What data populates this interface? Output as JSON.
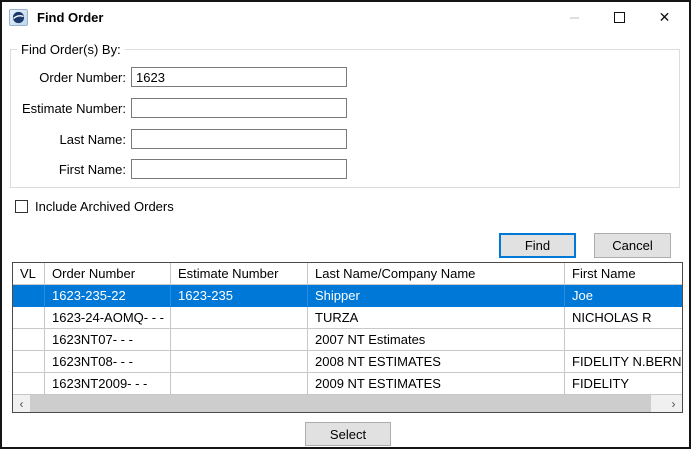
{
  "window": {
    "title": "Find Order",
    "controls": {
      "minimize_glyph": "─",
      "close_glyph": "✕"
    }
  },
  "search_panel": {
    "legend": "Find Order(s) By:",
    "fields": [
      {
        "label": "Order Number:",
        "value": "1623"
      },
      {
        "label": "Estimate Number:",
        "value": ""
      },
      {
        "label": "Last Name:",
        "value": ""
      },
      {
        "label": "First Name:",
        "value": ""
      }
    ]
  },
  "archived_checkbox": {
    "label": "Include Archived Orders",
    "checked": false
  },
  "buttons": {
    "find": "Find",
    "cancel": "Cancel",
    "select": "Select"
  },
  "table": {
    "columns": [
      "VL",
      "Order Number",
      "Estimate Number",
      "Last Name/Company Name",
      "First Name"
    ],
    "rows": [
      {
        "vl": "",
        "order_number": "1623-235-22",
        "estimate_number": "1623-235",
        "last_name": "Shipper",
        "first_name": "Joe",
        "selected": true
      },
      {
        "vl": "",
        "order_number": "1623-24-AOMQ- - -",
        "estimate_number": "",
        "last_name": "TURZA",
        "first_name": "NICHOLAS R",
        "selected": false
      },
      {
        "vl": "",
        "order_number": "1623NT07- - -",
        "estimate_number": "",
        "last_name": "2007 NT Estimates",
        "first_name": "",
        "selected": false
      },
      {
        "vl": "",
        "order_number": "1623NT08- - -",
        "estimate_number": "",
        "last_name": "2008 NT ESTIMATES",
        "first_name": "FIDELITY N.BERN",
        "selected": false
      },
      {
        "vl": "",
        "order_number": "1623NT2009- - -",
        "estimate_number": "",
        "last_name": "2009 NT ESTIMATES",
        "first_name": "FIDELITY",
        "selected": false
      }
    ]
  },
  "scrollbar": {
    "left_glyph": "‹",
    "right_glyph": "›"
  },
  "colors": {
    "selection": "#0078d7",
    "default_button_border": "#0078d7",
    "button_bg": "#e1e1e1"
  }
}
